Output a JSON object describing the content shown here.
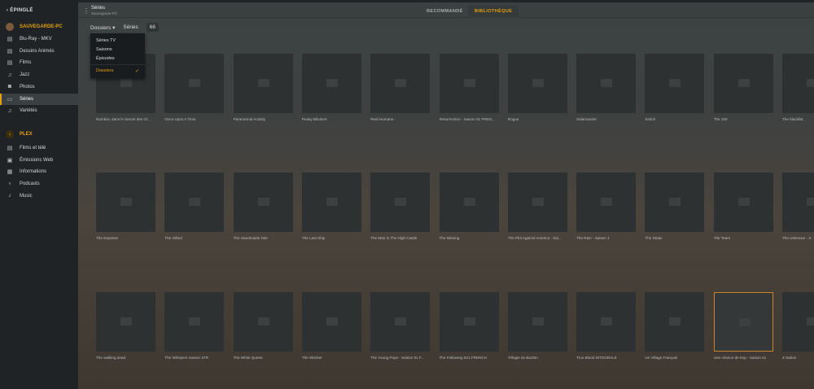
{
  "sidebar": {
    "back": "‹ ÉPINGLÉ",
    "server": "SAUVEGARDE-PC",
    "items": [
      {
        "label": "Blu-Ray - MKV",
        "icon": "film-icon",
        "glyph": "▤"
      },
      {
        "label": "Dessins Animés",
        "icon": "film-icon",
        "glyph": "▤"
      },
      {
        "label": "Films",
        "icon": "film-icon",
        "glyph": "▤"
      },
      {
        "label": "Jazz",
        "icon": "music-icon",
        "glyph": "♫"
      },
      {
        "label": "Photos",
        "icon": "camera-icon",
        "glyph": "◙"
      },
      {
        "label": "Séries",
        "icon": "tv-icon",
        "glyph": "▭"
      },
      {
        "label": "Variétés",
        "icon": "music-icon",
        "glyph": "♫"
      }
    ],
    "plex": "PLEX",
    "plex_items": [
      {
        "label": "Films et télé",
        "icon": "film-icon",
        "glyph": "▤"
      },
      {
        "label": "Émissions Web",
        "icon": "web-icon",
        "glyph": "▣"
      },
      {
        "label": "Informations",
        "icon": "news-icon",
        "glyph": "▦"
      },
      {
        "label": "Podcasts",
        "icon": "mic-icon",
        "glyph": "♆"
      },
      {
        "label": "Music",
        "icon": "music-icon",
        "glyph": "♪"
      }
    ]
  },
  "header": {
    "title": "Séries",
    "subtitle": "Sauvegarde-PC",
    "tabs": [
      "RECOMMANDÉ",
      "BIBLIOTHÈQUE"
    ]
  },
  "filters": {
    "view": "Dossiers ▾",
    "type": "Séries",
    "count": "66"
  },
  "dropdown": {
    "options": [
      "Séries TV",
      "Saisons",
      "Épisodes"
    ],
    "selected": "Dossiers"
  },
  "accent": "#e5a00d",
  "grid": [
    [
      "Nomkov, dans le Secret des Gl...",
      "Once Upon A Time",
      "Paranormal Activity",
      "Peaky Blinders",
      "Real Humans -",
      "Resurrection - Saison 01 FREN...",
      "Rogue",
      "Salamandre",
      "Snitch",
      "The 100",
      "The blacklist"
    ],
    [
      "The Expanse",
      "The Gifted",
      "The Handmaids Tale",
      "The Last Ship",
      "The Man in The High Castle",
      "The Missing",
      "The Plot Against America - Sai...",
      "The Rain - Saison 1",
      "The Strain",
      "The Team",
      "The Unknown - S"
    ],
    [
      "The walking dead",
      "The Whispers Saison 1FR",
      "The White Queen",
      "The Witcher",
      "The Young Pope - Saison 01 F...",
      "The Following.S01.FRENCH",
      "Trilogie du Bazâm",
      "True Blood INTEGRALE",
      "Un Village Français",
      "Une chance de trop - Saison 01",
      "Z Nation"
    ]
  ]
}
